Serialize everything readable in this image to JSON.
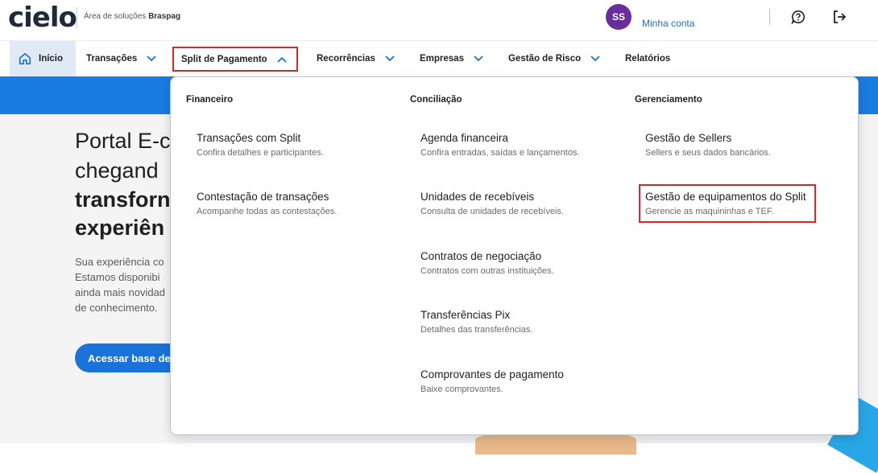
{
  "header": {
    "logo": "cielo",
    "area_prefix": "Área de soluções",
    "area_brand": "Braspag",
    "avatar_initials": "SS",
    "account_label": "Minha conta"
  },
  "nav": {
    "home": "Início",
    "transacoes": "Transações",
    "split": "Split de Pagamento",
    "recorrencias": "Recorrências",
    "empresas": "Empresas",
    "risco": "Gestão de Risco",
    "relatorios": "Relatórios"
  },
  "hero": {
    "line1": "Portal E-c",
    "line2": "chegand",
    "line3": "transforn",
    "line4": "experiên",
    "p1": "Sua experiência co",
    "p2": "Estamos disponibi",
    "p3": "ainda mais novidad",
    "p4": "de conhecimento.",
    "button": "Acessar base de"
  },
  "dropdown": {
    "financeiro": {
      "heading": "Financeiro",
      "items": [
        {
          "title": "Transações com Split",
          "desc": "Confira detalhes e participantes."
        },
        {
          "title": "Contestação de transações",
          "desc": "Acompanhe todas as contestações."
        }
      ]
    },
    "conciliacao": {
      "heading": "Conciliação",
      "items": [
        {
          "title": "Agenda financeira",
          "desc": "Confira entradas, saídas e lançamentos."
        },
        {
          "title": "Unidades de recebíveis",
          "desc": "Consulta de unidades de recebíveis."
        },
        {
          "title": "Contratos de negociação",
          "desc": "Contratos com outras instituições."
        },
        {
          "title": "Transferências Pix",
          "desc": "Detalhes das transferências."
        },
        {
          "title": "Comprovantes de pagamento",
          "desc": "Baixe comprovantes."
        }
      ]
    },
    "gerenciamento": {
      "heading": "Gerenciamento",
      "items": [
        {
          "title": "Gestão de Sellers",
          "desc": "Sellers e seus dados bancários."
        },
        {
          "title": "Gestão de equipamentos do Split",
          "desc": "Gerencie as maquininhas e TEF."
        }
      ]
    }
  },
  "colors": {
    "brand_blue": "#1a7be0",
    "link_blue": "#1a73c9",
    "highlight_red": "#d62828",
    "avatar_purple": "#6a2e9c"
  }
}
